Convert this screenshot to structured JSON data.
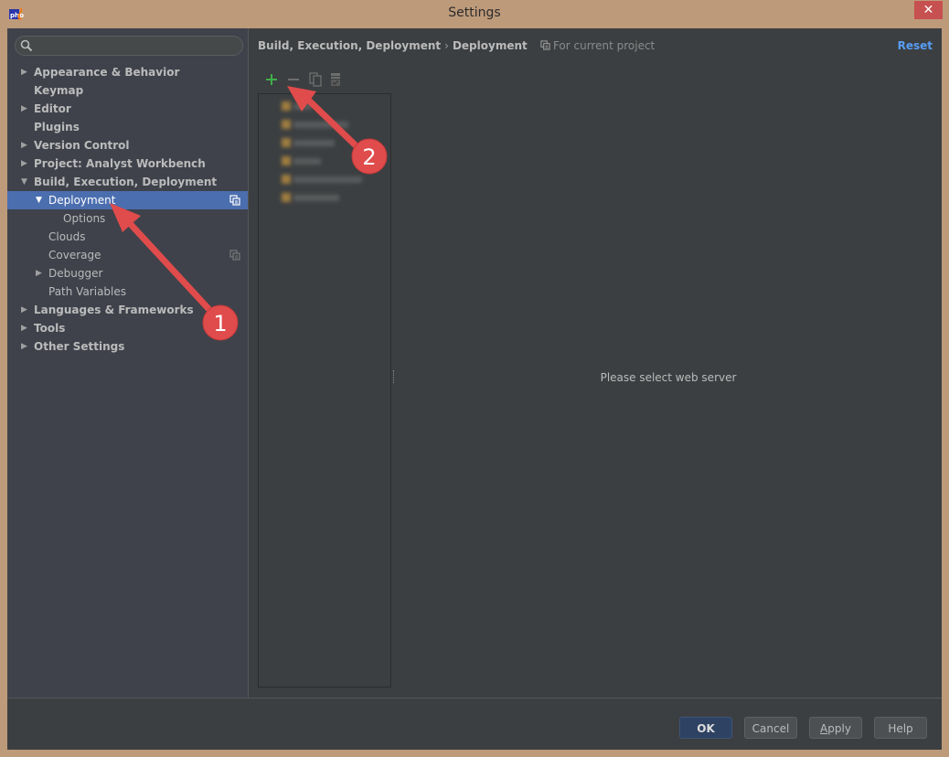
{
  "window": {
    "title": "Settings",
    "close_label": "✕"
  },
  "sidebar": {
    "search_placeholder": "",
    "items": [
      {
        "label": "Appearance & Behavior",
        "expandable": true,
        "expanded": false,
        "bold": true,
        "level": 0
      },
      {
        "label": "Keymap",
        "expandable": false,
        "bold": true,
        "level": 0
      },
      {
        "label": "Editor",
        "expandable": true,
        "expanded": false,
        "bold": true,
        "level": 0
      },
      {
        "label": "Plugins",
        "expandable": false,
        "bold": true,
        "level": 0
      },
      {
        "label": "Version Control",
        "expandable": true,
        "expanded": false,
        "bold": true,
        "level": 0
      },
      {
        "label": "Project: Analyst Workbench",
        "expandable": true,
        "expanded": false,
        "bold": true,
        "level": 0
      },
      {
        "label": "Build, Execution, Deployment",
        "expandable": true,
        "expanded": true,
        "bold": true,
        "level": 0
      },
      {
        "label": "Deployment",
        "expandable": true,
        "expanded": true,
        "selected": true,
        "project_scoped": true,
        "level": 1
      },
      {
        "label": "Options",
        "level": 2
      },
      {
        "label": "Clouds",
        "level": 1
      },
      {
        "label": "Coverage",
        "project_scoped": true,
        "level": 1
      },
      {
        "label": "Debugger",
        "expandable": true,
        "expanded": false,
        "level": 1
      },
      {
        "label": "Path Variables",
        "level": 1
      },
      {
        "label": "Languages & Frameworks",
        "expandable": true,
        "expanded": false,
        "bold": true,
        "level": 0
      },
      {
        "label": "Tools",
        "expandable": true,
        "expanded": false,
        "bold": true,
        "level": 0
      },
      {
        "label": "Other Settings",
        "expandable": true,
        "expanded": false,
        "bold": true,
        "level": 0
      }
    ]
  },
  "main": {
    "breadcrumb": {
      "parent": "Build, Execution, Deployment",
      "separator": "›",
      "current": "Deployment",
      "scope": "For current project"
    },
    "reset_label": "Reset",
    "toolbar": {
      "add": "+",
      "remove": "−",
      "copy": "copy-icon",
      "default": "set-default-icon"
    },
    "server_list_count_blurred": 6,
    "empty_message": "Please select web server"
  },
  "footer": {
    "ok": "OK",
    "cancel": "Cancel",
    "apply_mnemonic": "A",
    "apply_rest": "pply",
    "help": "Help"
  },
  "annotations": [
    {
      "number": "1",
      "target": "Deployment tree item"
    },
    {
      "number": "2",
      "target": "Add server button"
    }
  ],
  "colors": {
    "selection": "#4b6eaf",
    "accent_link": "#589df6",
    "add_green": "#3fae49",
    "annotation_red": "#e04b4b",
    "title_bar": "#bd9a7a"
  }
}
